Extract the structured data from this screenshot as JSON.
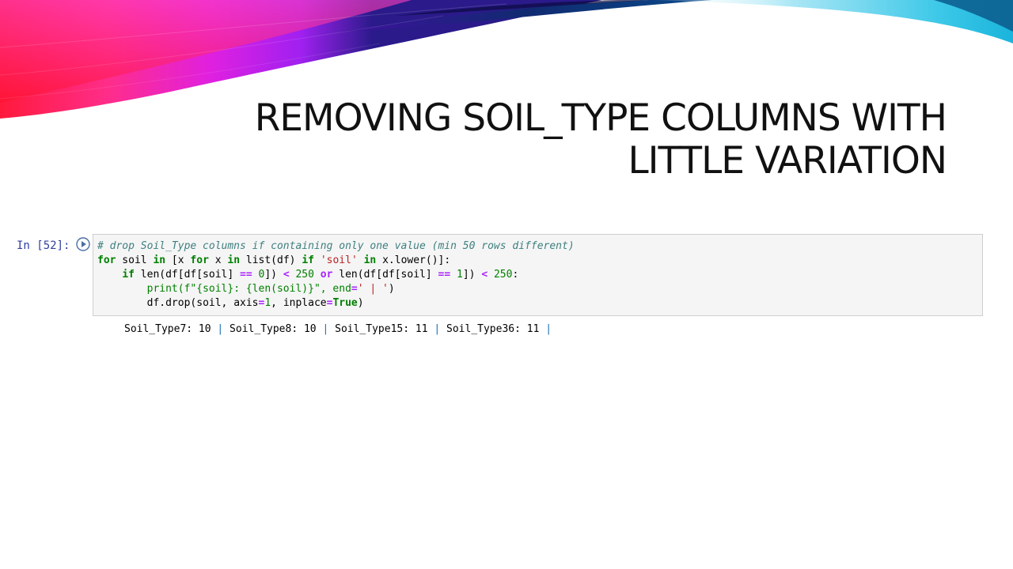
{
  "slide": {
    "title_line1": "REMOVING SOIL_TYPE COLUMNS WITH",
    "title_line2": "LITTLE VARIATION"
  },
  "notebook": {
    "prompt": "In [52]:",
    "code": {
      "comment": "# drop Soil_Type columns if containing only one value (min 50 rows different)",
      "l2": {
        "for": "for",
        "t1": " soil ",
        "in1": "in",
        "t2": " [x ",
        "for2": "for",
        "t3": " x ",
        "in2": "in",
        "t4": " list(df) ",
        "if": "if",
        "t5": " ",
        "s": "'soil'",
        "t6": " ",
        "in3": "in",
        "t7": " x.lower()]:"
      },
      "l3": {
        "pad": "    ",
        "if": "if",
        "t1": " len(df[df[soil] ",
        "eq1": "==",
        "t2": " ",
        "n0": "0",
        "t3": "]) ",
        "lt1": "<",
        "t4": " ",
        "n250a": "250",
        "t5": " ",
        "or": "or",
        "t6": " len(df[df[soil] ",
        "eq2": "==",
        "t7": " ",
        "n1": "1",
        "t8": "]) ",
        "lt2": "<",
        "t9": " ",
        "n250b": "250",
        "t10": ":"
      },
      "l4": {
        "pad": "        ",
        "t1": "print(f\"{soil}: {len(soil)}\", end",
        "eq": "=",
        "s": "' | '",
        "t2": ")"
      },
      "l5": {
        "pad": "        ",
        "t1": "df.drop(soil, axis",
        "eq1": "=",
        "n1": "1",
        "t2": ", inplace",
        "eq2": "=",
        "true": "True",
        "t3": ")"
      }
    },
    "output": [
      {
        "text": "Soil_Type7: 10 ",
        "sep": "|"
      },
      {
        "text": " Soil_Type8: 10 ",
        "sep": "|"
      },
      {
        "text": " Soil_Type15: 11 ",
        "sep": "|"
      },
      {
        "text": " Soil_Type36: 11 ",
        "sep": "|"
      }
    ]
  }
}
